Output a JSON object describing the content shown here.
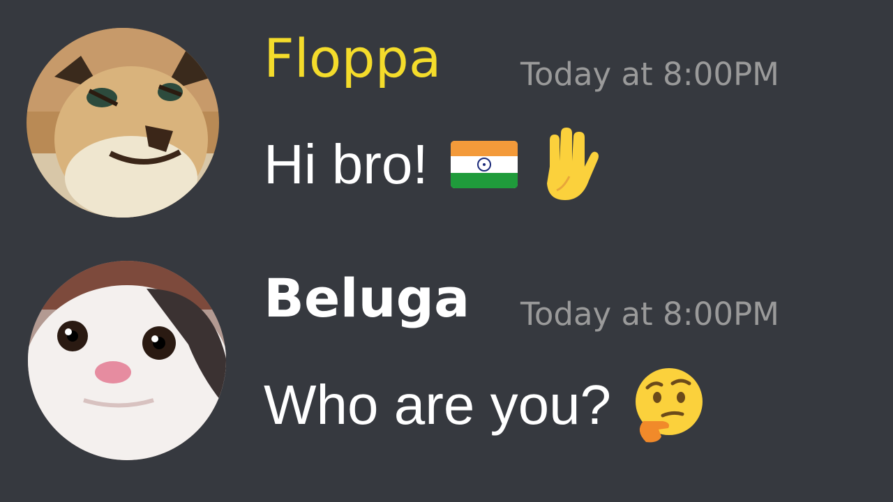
{
  "messages": [
    {
      "username": "Floppa",
      "username_color": "#f4dc2b",
      "timestamp": "Today at 8:00PM",
      "text": "Hi bro!",
      "emojis": [
        "india-flag-icon",
        "raised-hand-icon"
      ]
    },
    {
      "username": "Beluga",
      "username_color": "#ffffff",
      "timestamp": "Today at 8:00PM",
      "text": "Who are you?",
      "emojis": [
        "thinking-face-icon"
      ]
    }
  ],
  "colors": {
    "background": "#36393f",
    "timestamp": "#9a9a9a",
    "message_text": "#ffffff"
  }
}
